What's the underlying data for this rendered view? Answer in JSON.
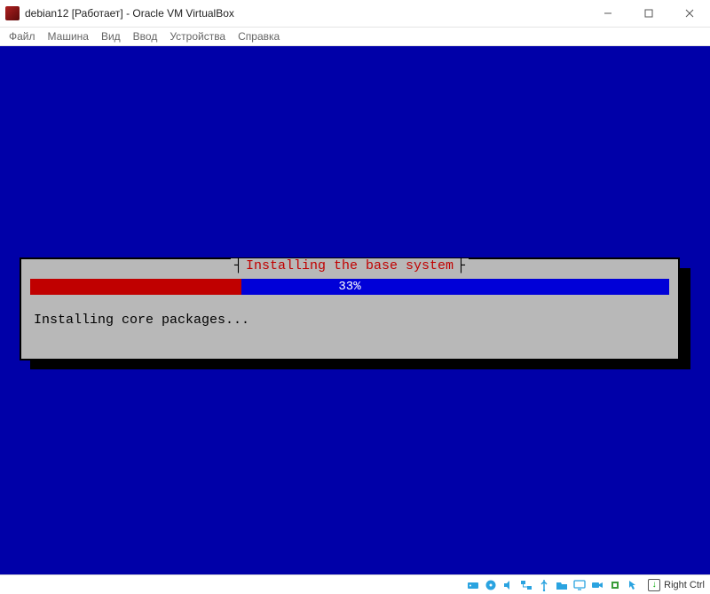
{
  "window": {
    "title": "debian12 [Работает] - Oracle VM VirtualBox"
  },
  "menu": {
    "items": [
      "Файл",
      "Машина",
      "Вид",
      "Ввод",
      "Устройства",
      "Справка"
    ]
  },
  "installer": {
    "dialog_title": "Installing the base system",
    "progress_percent": 33,
    "progress_label": "33%",
    "status": "Installing core packages..."
  },
  "statusbar": {
    "icons": [
      "hard-disk-icon",
      "optical-disc-icon",
      "audio-icon",
      "network-icon",
      "usb-icon",
      "shared-folder-icon",
      "display-icon",
      "recording-icon",
      "cpu-icon",
      "mouse-integration-icon"
    ],
    "host_key": "Right Ctrl"
  },
  "colors": {
    "guest_bg": "#0000a8",
    "dialog_bg": "#b8b8b8",
    "progress_track": "#0000d8",
    "progress_fill": "#c00000",
    "title_red": "#c00000"
  }
}
